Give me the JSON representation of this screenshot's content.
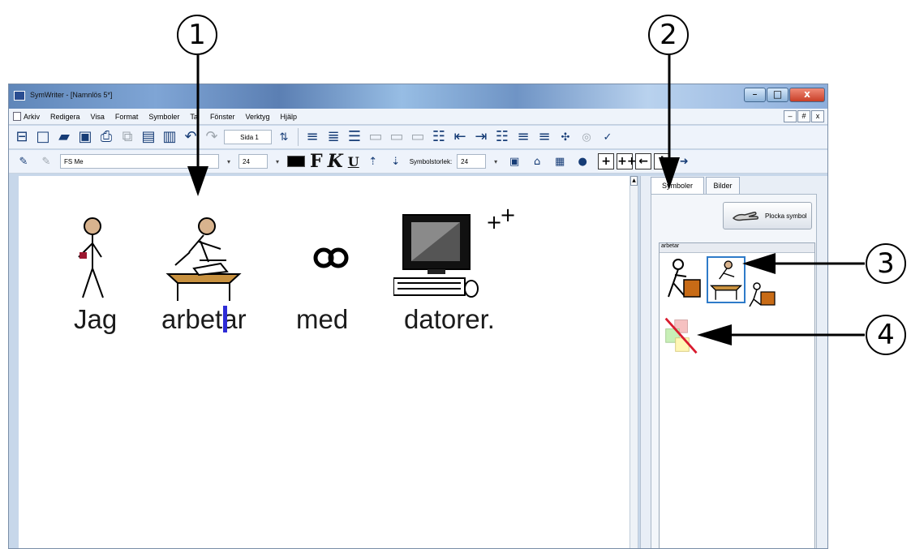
{
  "callouts": [
    "1",
    "2",
    "3",
    "4"
  ],
  "window": {
    "title": "SymWriter - [Namnlös 5*]",
    "controls": [
      "–",
      "□",
      "x"
    ]
  },
  "menu": {
    "items": [
      "Arkiv",
      "Redigera",
      "Visa",
      "Format",
      "Symboler",
      "Tal",
      "Fönster",
      "Verktyg",
      "Hjälp"
    ],
    "mdi_controls": [
      "–",
      "#",
      "x"
    ]
  },
  "toolbar": {
    "page": "Sida 1",
    "font": "FS Me",
    "font_size": "24",
    "bold": "F",
    "italic": "K",
    "underline": "U",
    "symbol_size_label": "Symbolstorlek:",
    "symbol_size": "24",
    "symbol_buttons": [
      "+",
      "++",
      "←",
      "!"
    ]
  },
  "document": {
    "words": [
      "Jag",
      "arbetar",
      "med",
      "datorer."
    ],
    "computer_mark": "+",
    "computer_plus": "+"
  },
  "side_panel": {
    "tabs": [
      "Symboler",
      "Bilder"
    ],
    "pick_button": "Plocka symbol",
    "word": "arbetar"
  },
  "colors": {
    "title_blue": "#5f86b9",
    "selection_blue": "#2e7bc9",
    "cursor_blue": "#2d2bd6",
    "arrow": "#000000"
  }
}
